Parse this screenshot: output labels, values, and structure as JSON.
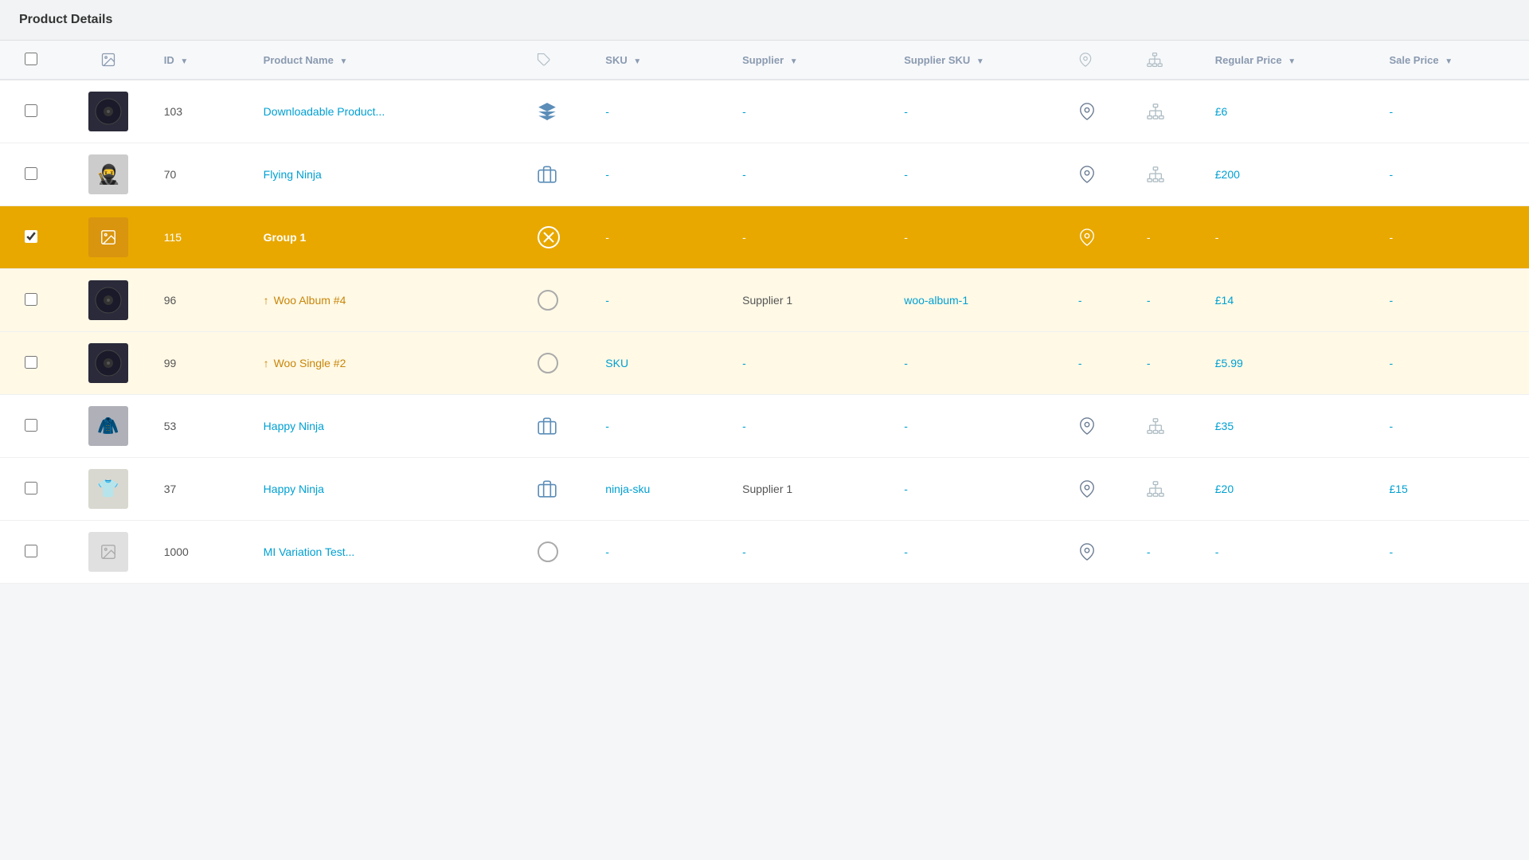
{
  "page": {
    "title": "Product Details"
  },
  "table": {
    "columns": [
      {
        "id": "checkbox",
        "label": ""
      },
      {
        "id": "image",
        "label": "image-icon"
      },
      {
        "id": "id",
        "label": "ID",
        "sortable": true,
        "sorted": "desc"
      },
      {
        "id": "name",
        "label": "Product Name",
        "sortable": true
      },
      {
        "id": "tag",
        "label": "tag-icon"
      },
      {
        "id": "sku",
        "label": "SKU",
        "sortable": true
      },
      {
        "id": "supplier",
        "label": "Supplier",
        "sortable": true
      },
      {
        "id": "supplier_sku",
        "label": "Supplier SKU",
        "sortable": true
      },
      {
        "id": "location",
        "label": "location-icon"
      },
      {
        "id": "hierarchy",
        "label": "hierarchy-icon"
      },
      {
        "id": "regular_price",
        "label": "Regular Price",
        "sortable": true
      },
      {
        "id": "sale_price",
        "label": "Sale Price",
        "sortable": true
      }
    ],
    "rows": [
      {
        "id": 103,
        "name": "Downloadable Product...",
        "type": "downloadable",
        "sku": "-",
        "supplier": "-",
        "supplier_sku": "-",
        "regular_price": "£6",
        "sale_price": "-",
        "selected": false,
        "child": false,
        "has_image": true,
        "image_type": "disc"
      },
      {
        "id": 70,
        "name": "Flying Ninja",
        "type": "simple",
        "sku": "-",
        "supplier": "-",
        "supplier_sku": "-",
        "regular_price": "£200",
        "sale_price": "-",
        "selected": false,
        "child": false,
        "has_image": true,
        "image_type": "ninja"
      },
      {
        "id": 115,
        "name": "Group 1",
        "type": "grouped",
        "sku": "-",
        "supplier": "-",
        "supplier_sku": "-",
        "regular_price": "-",
        "sale_price": "-",
        "selected": true,
        "child": false,
        "has_image": false,
        "image_type": "placeholder"
      },
      {
        "id": 96,
        "name": "Woo Album #4",
        "type": "variable",
        "sku": "-",
        "supplier": "Supplier 1",
        "supplier_sku": "woo-album-1",
        "regular_price": "£14",
        "sale_price": "-",
        "selected": false,
        "child": true,
        "has_image": true,
        "image_type": "disc"
      },
      {
        "id": 99,
        "name": "Woo Single #2",
        "type": "variable",
        "sku": "SKU",
        "supplier": "-",
        "supplier_sku": "-",
        "regular_price": "£5.99",
        "sale_price": "-",
        "selected": false,
        "child": true,
        "has_image": true,
        "image_type": "disc2"
      },
      {
        "id": 53,
        "name": "Happy Ninja",
        "type": "simple",
        "sku": "-",
        "supplier": "-",
        "supplier_sku": "-",
        "regular_price": "£35",
        "sale_price": "-",
        "selected": false,
        "child": false,
        "has_image": true,
        "image_type": "hoodie"
      },
      {
        "id": 37,
        "name": "Happy Ninja",
        "type": "simple",
        "sku": "ninja-sku",
        "supplier": "Supplier 1",
        "supplier_sku": "-",
        "regular_price": "£20",
        "sale_price": "£15",
        "selected": false,
        "child": false,
        "has_image": true,
        "image_type": "shirt"
      },
      {
        "id": 1000,
        "name": "MI Variation Test...",
        "type": "variable2",
        "sku": "-",
        "supplier": "-",
        "supplier_sku": "-",
        "regular_price": "-",
        "sale_price": "-",
        "selected": false,
        "child": false,
        "has_image": false,
        "image_type": "placeholder"
      }
    ]
  }
}
